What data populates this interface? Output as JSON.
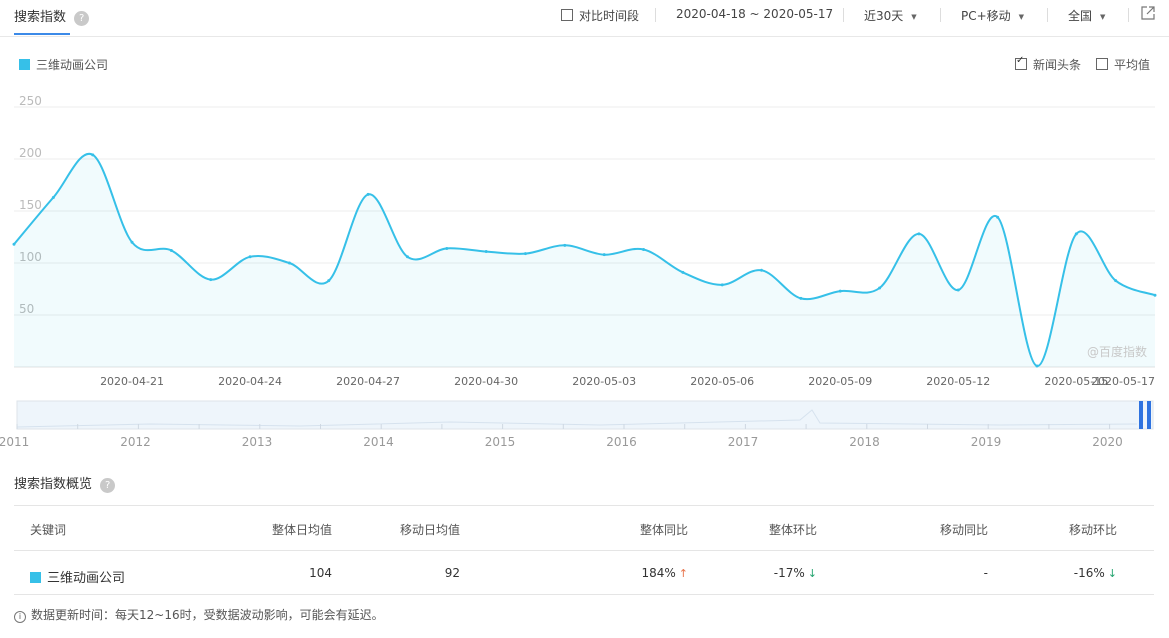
{
  "header": {
    "title": "搜索指数",
    "help": "?",
    "compare_label": "对比时间段",
    "date_range": "2020-04-18 ~ 2020-05-17",
    "period": "近30天",
    "device": "PC+移动",
    "region": "全国",
    "export_icon": "external-link-icon"
  },
  "legend": {
    "series_name": "三维动画公司",
    "news_label": "新闻头条",
    "avg_label": "平均值",
    "news_checked": true,
    "avg_checked": false
  },
  "watermark": "@百度指数",
  "colors": {
    "accent": "#36c0e8",
    "tab": "#3c8ae8",
    "up": "#e8734a",
    "down": "#22a36e"
  },
  "chart_data": {
    "type": "area",
    "ylim": [
      0,
      250
    ],
    "yticks": [
      "250",
      "200",
      "150",
      "100",
      "50"
    ],
    "xtick_labels": [
      "2020-04-21",
      "2020-04-24",
      "2020-04-27",
      "2020-04-30",
      "2020-05-03",
      "2020-05-06",
      "2020-05-09",
      "2020-05-12",
      "2020-05-15",
      "2020-05-17"
    ],
    "x": [
      "2020-04-18",
      "2020-04-19",
      "2020-04-20",
      "2020-04-21",
      "2020-04-22",
      "2020-04-23",
      "2020-04-24",
      "2020-04-25",
      "2020-04-26",
      "2020-04-27",
      "2020-04-28",
      "2020-04-29",
      "2020-04-30",
      "2020-05-01",
      "2020-05-02",
      "2020-05-03",
      "2020-05-04",
      "2020-05-05",
      "2020-05-06",
      "2020-05-07",
      "2020-05-08",
      "2020-05-09",
      "2020-05-10",
      "2020-05-11",
      "2020-05-12",
      "2020-05-13",
      "2020-05-14",
      "2020-05-15",
      "2020-05-16",
      "2020-05-17"
    ],
    "series": [
      {
        "name": "三维动画公司",
        "values": [
          118,
          163,
          204,
          120,
          112,
          84,
          106,
          100,
          83,
          166,
          106,
          114,
          111,
          109,
          117,
          108,
          113,
          91,
          79,
          93,
          66,
          73,
          76,
          128,
          74,
          144,
          1,
          128,
          83,
          69
        ]
      }
    ],
    "timeline_labels": [
      "2011",
      "2012",
      "2013",
      "2014",
      "2015",
      "2016",
      "2017",
      "2018",
      "2019",
      "2020"
    ]
  },
  "overview": {
    "title": "搜索指数概览",
    "columns": [
      "关键词",
      "整体日均值",
      "移动日均值",
      "整体同比",
      "整体环比",
      "移动同比",
      "移动环比"
    ],
    "rows": [
      {
        "keyword": "三维动画公司",
        "overall_avg": "104",
        "mobile_avg": "92",
        "overall_yoy": "184%",
        "overall_mom": "-17%",
        "mobile_yoy": "-",
        "mobile_mom": "-16%"
      }
    ],
    "note": "数据更新时间：每天12~16时，受数据波动影响，可能会有延迟。"
  }
}
